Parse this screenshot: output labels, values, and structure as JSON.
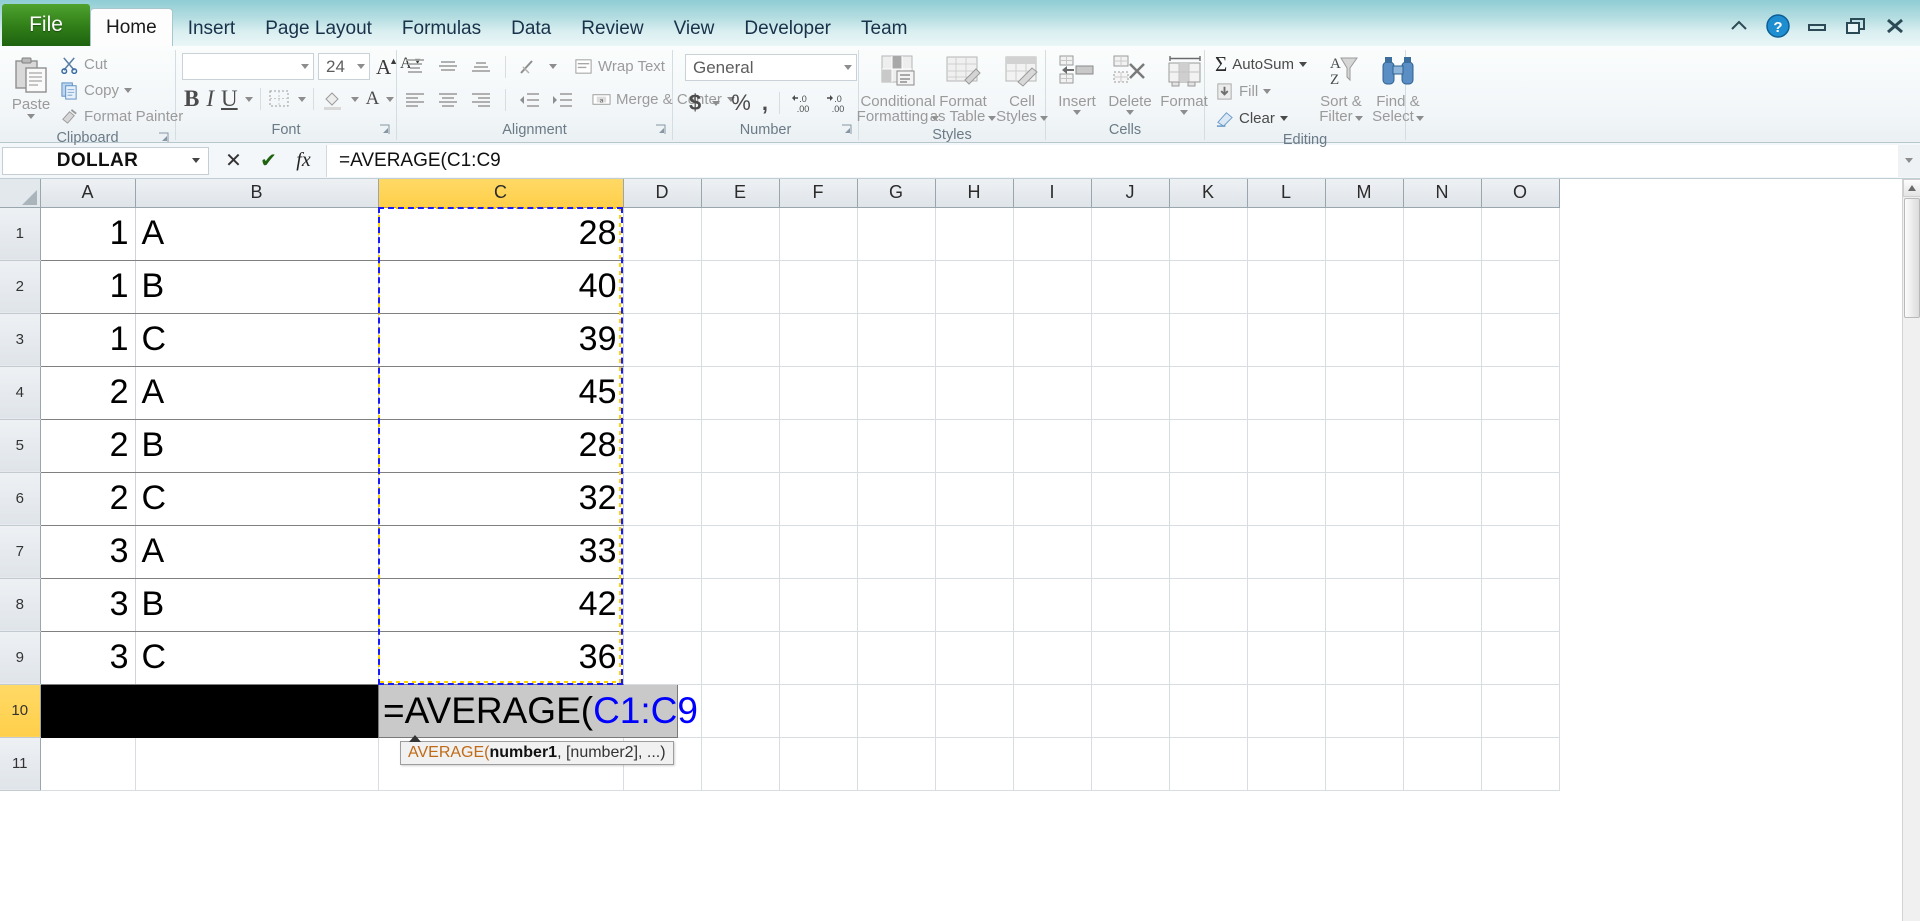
{
  "window": {
    "controls": [
      {
        "name": "minimize-ribbon-icon",
        "glyph": "^"
      },
      {
        "name": "help-icon",
        "glyph": "?"
      },
      {
        "name": "minimize-icon",
        "glyph": "—"
      },
      {
        "name": "restore-icon",
        "glyph": "❐"
      },
      {
        "name": "close-icon",
        "glyph": "✕"
      }
    ]
  },
  "ribbon": {
    "file_tab": "File",
    "tabs": [
      {
        "label": "Home",
        "active": true
      },
      {
        "label": "Insert",
        "active": false
      },
      {
        "label": "Page Layout",
        "active": false
      },
      {
        "label": "Formulas",
        "active": false
      },
      {
        "label": "Data",
        "active": false
      },
      {
        "label": "Review",
        "active": false
      },
      {
        "label": "View",
        "active": false
      },
      {
        "label": "Developer",
        "active": false
      },
      {
        "label": "Team",
        "active": false
      }
    ],
    "groups": {
      "clipboard": {
        "label": "Clipboard",
        "paste": "Paste",
        "cut": "Cut",
        "copy": "Copy",
        "format_painter": "Format Painter"
      },
      "font": {
        "label": "Font",
        "font_name": "",
        "font_size": "24",
        "bold": "B",
        "italic": "I",
        "underline": "U",
        "grow_font": "A",
        "shrink_font": "A"
      },
      "alignment": {
        "label": "Alignment",
        "wrap_text": "Wrap Text",
        "merge_center": "Merge & Center"
      },
      "number": {
        "label": "Number",
        "format": "General",
        "currency": "$",
        "percent": "%",
        "comma": ",",
        "increase_decimal": ".0",
        "decrease_decimal": ".00"
      },
      "styles": {
        "label": "Styles",
        "conditional_formatting": "Conditional\nFormatting",
        "conditional_formatting_l1": "Conditional",
        "conditional_formatting_l2": "Formatting",
        "format_as_table_l1": "Format",
        "format_as_table_l2": "as Table",
        "cell_styles_l1": "Cell",
        "cell_styles_l2": "Styles"
      },
      "cells": {
        "label": "Cells",
        "insert": "Insert",
        "delete": "Delete",
        "format": "Format"
      },
      "editing": {
        "label": "Editing",
        "autosum": "AutoSum",
        "fill": "Fill",
        "clear": "Clear",
        "sort_filter_l1": "Sort &",
        "sort_filter_l2": "Filter",
        "find_select_l1": "Find &",
        "find_select_l2": "Select"
      }
    }
  },
  "formula_bar": {
    "name_box": "DOLLAR",
    "cancel": "✕",
    "enter": "✔",
    "insert_function": "fx",
    "formula": "=AVERAGE(C1:C9"
  },
  "sheet": {
    "columns": [
      "A",
      "B",
      "C",
      "D",
      "E",
      "F",
      "G",
      "H",
      "I",
      "J",
      "K",
      "L",
      "M",
      "N",
      "O"
    ],
    "highlighted_column": "C",
    "rows": [
      "1",
      "2",
      "3",
      "4",
      "5",
      "6",
      "7",
      "8",
      "9",
      "10",
      "11"
    ],
    "highlighted_row": "10",
    "data": [
      {
        "row": "1",
        "A": "1",
        "B": "A",
        "C": "28"
      },
      {
        "row": "2",
        "A": "1",
        "B": "B",
        "C": "40"
      },
      {
        "row": "3",
        "A": "1",
        "B": "C",
        "C": "39"
      },
      {
        "row": "4",
        "A": "2",
        "B": "A",
        "C": "45"
      },
      {
        "row": "5",
        "A": "2",
        "B": "B",
        "C": "28"
      },
      {
        "row": "6",
        "A": "2",
        "B": "C",
        "C": "32"
      },
      {
        "row": "7",
        "A": "3",
        "B": "A",
        "C": "33"
      },
      {
        "row": "8",
        "A": "3",
        "B": "B",
        "C": "42"
      },
      {
        "row": "9",
        "A": "3",
        "B": "C",
        "C": "36"
      }
    ],
    "selection_range": "C1:C9",
    "cell_editor": {
      "cell": "C10",
      "function_part": "=AVERAGE(",
      "reference_part": "C1:C9"
    },
    "tooltip": {
      "function": "AVERAGE(",
      "arg1": "number1",
      "rest": ", [number2], ...)"
    }
  },
  "colors": {
    "accent_green": "#2f7d18",
    "header_highlight": "#ffd966",
    "reference_blue": "#0000ff",
    "title_bar": "#b4dde1"
  }
}
